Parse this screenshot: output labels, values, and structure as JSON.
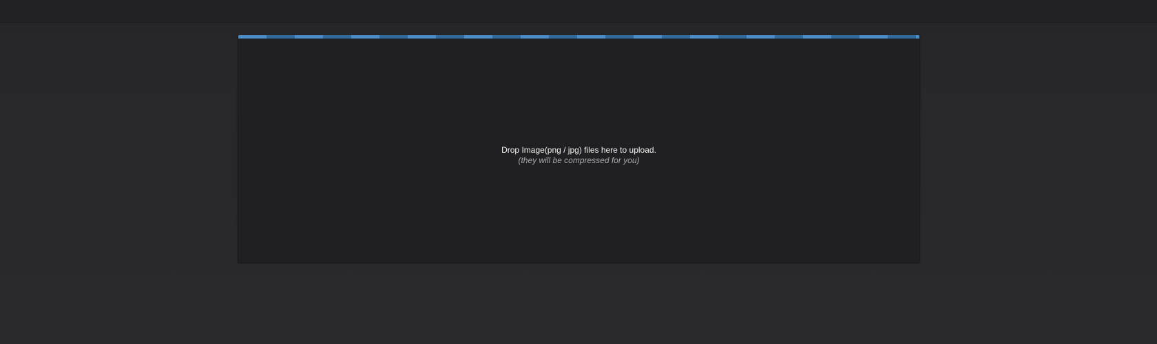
{
  "upload": {
    "drop_message": "Drop Image(png / jpg) files here to upload.",
    "drop_hint": "(they will be compressed for you)"
  },
  "colors": {
    "stripe_primary": "#4a8cc7",
    "stripe_secondary": "#2f6a9e",
    "panel_background": "#202022",
    "page_background": "#2a2a2c"
  }
}
